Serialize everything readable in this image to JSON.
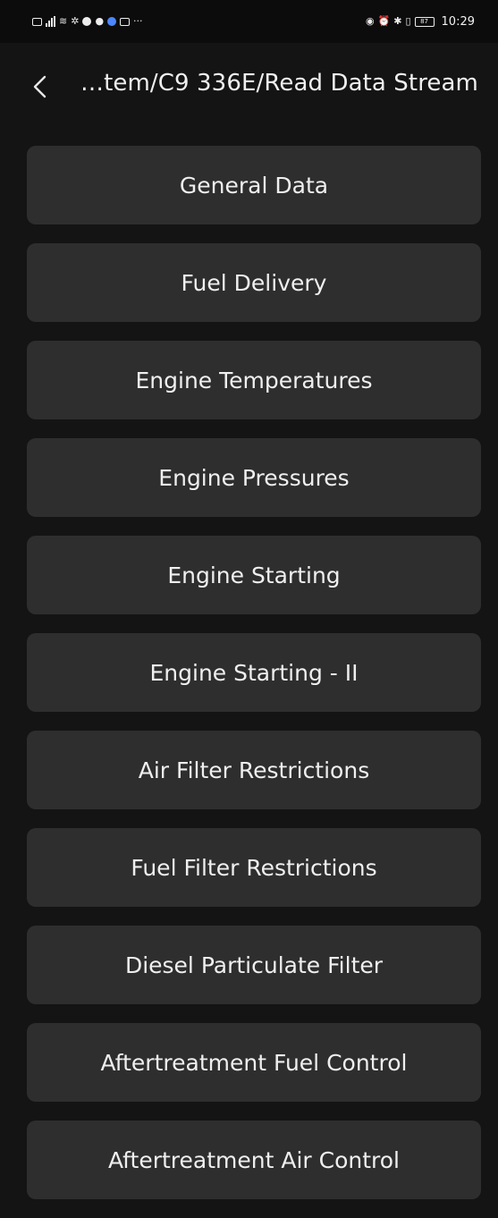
{
  "status_bar": {
    "time": "10:29",
    "battery": "87",
    "left_icons": [
      "sim-icon",
      "signal-icon",
      "wifi-icon",
      "location-icon",
      "notification-icon",
      "chat-icon",
      "app-icon",
      "gallery-icon",
      "more-notifications-icon"
    ],
    "right_icons": [
      "eye-icon",
      "alarm-icon",
      "bluetooth-icon",
      "vibrate-icon",
      "battery-icon"
    ],
    "more": "···"
  },
  "header": {
    "title": "…tem/C9 336E/Read Data Stream"
  },
  "menu": {
    "items": [
      {
        "label": "General Data"
      },
      {
        "label": "Fuel Delivery"
      },
      {
        "label": "Engine Temperatures"
      },
      {
        "label": "Engine Pressures"
      },
      {
        "label": "Engine Starting"
      },
      {
        "label": "Engine Starting - II"
      },
      {
        "label": "Air Filter Restrictions"
      },
      {
        "label": "Fuel Filter Restrictions"
      },
      {
        "label": "Diesel Particulate Filter"
      },
      {
        "label": "Aftertreatment Fuel Control"
      },
      {
        "label": "Aftertreatment Air Control"
      }
    ]
  },
  "colors": {
    "background": "#141414",
    "button": "#2e2e2e",
    "text": "#efefef"
  }
}
